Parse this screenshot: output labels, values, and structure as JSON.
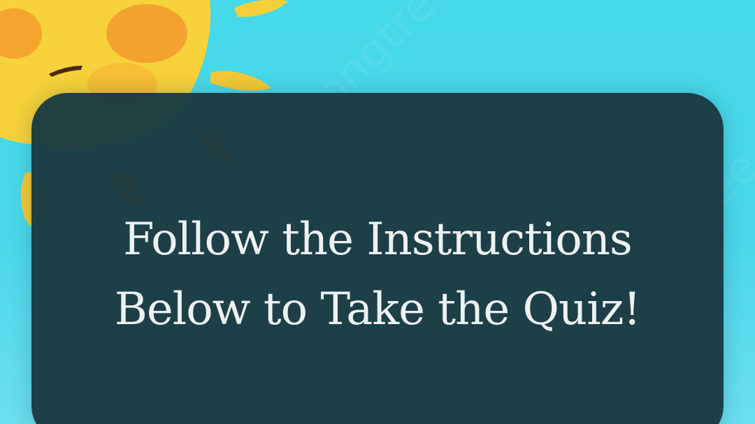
{
  "background": {
    "sky_color": "#46d9ea",
    "sun_color": "#f7d23a",
    "icon": "sun-illustration"
  },
  "card": {
    "background_color": "#1b3a42",
    "headline": "Follow the Instructions Below to Take the Quiz!"
  }
}
